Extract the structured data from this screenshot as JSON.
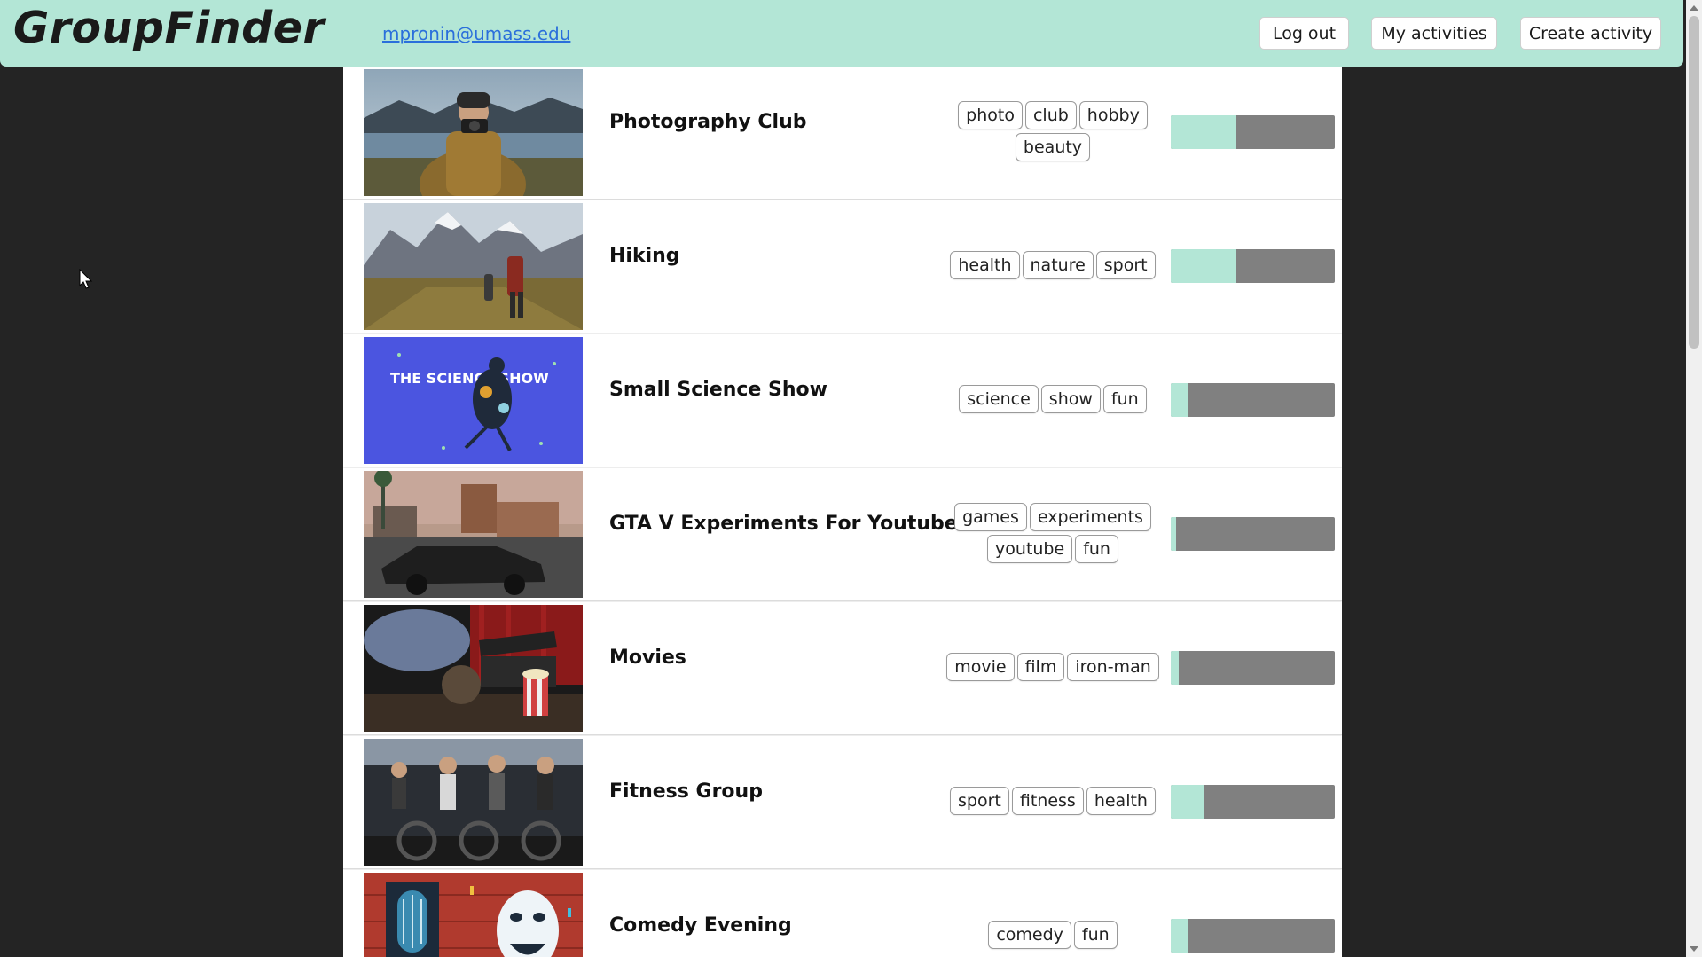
{
  "header": {
    "brand": "GroupFinder",
    "user_email": "mpronin@umass.edu",
    "buttons": {
      "logout": "Log out",
      "my_activities": "My activities",
      "create_activity": "Create activity"
    },
    "background": "#b3e6d6"
  },
  "activities": [
    {
      "title": "Photography Club",
      "tags": [
        "photo",
        "club",
        "hobby",
        "beauty"
      ],
      "progress": 0.4,
      "thumbnail": "photographer-by-lake"
    },
    {
      "title": "Hiking",
      "tags": [
        "health",
        "nature",
        "sport"
      ],
      "progress": 0.4,
      "thumbnail": "hikers-in-mountains"
    },
    {
      "title": "Small Science Show",
      "tags": [
        "science",
        "show",
        "fun"
      ],
      "progress": 0.1,
      "thumbnail": "science-show-poster"
    },
    {
      "title": "GTA V Experiments For Youtube",
      "tags": [
        "games",
        "experiments",
        "youtube",
        "fun"
      ],
      "progress": 0.03,
      "thumbnail": "car-on-street"
    },
    {
      "title": "Movies",
      "tags": [
        "movie",
        "film",
        "iron-man"
      ],
      "progress": 0.05,
      "thumbnail": "film-clapper-popcorn"
    },
    {
      "title": "Fitness Group",
      "tags": [
        "sport",
        "fitness",
        "health"
      ],
      "progress": 0.2,
      "thumbnail": "spin-class"
    },
    {
      "title": "Comedy Evening",
      "tags": [
        "comedy",
        "fun"
      ],
      "progress": 0.1,
      "thumbnail": "microphone-and-mask"
    }
  ],
  "science_poster_text": "THE SCIENCE SHOW",
  "colors": {
    "accent": "#b3e6d6",
    "bar_empty": "#808080",
    "page_background": "#242424"
  }
}
